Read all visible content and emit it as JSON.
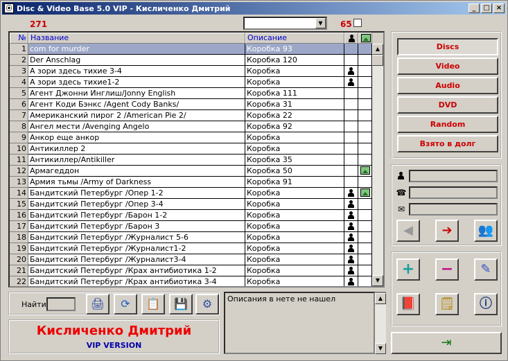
{
  "window": {
    "title": "Disc & Video Base 5.0  VIP -  Кисличенко Дмитрий",
    "app_icon": "disc-icon",
    "buttons": [
      "_",
      "□",
      "×"
    ]
  },
  "counts": {
    "total": "271",
    "right": "65"
  },
  "grid": {
    "headers": [
      "№",
      "Название",
      "Описание"
    ],
    "header_icons": [
      "person-icon",
      "picture-icon"
    ],
    "rows": [
      {
        "n": "1",
        "name": "com for murder",
        "desc": "Коробка 93",
        "person": false,
        "picture": false,
        "selected": true
      },
      {
        "n": "2",
        "name": "Der Anschlag",
        "desc": "Коробка 120",
        "person": false,
        "picture": false
      },
      {
        "n": "3",
        "name": "А зори здесь тихие 3-4",
        "desc": "Коробка",
        "person": true,
        "picture": false
      },
      {
        "n": "4",
        "name": "А зори здесь тихие1-2",
        "desc": "Коробка",
        "person": true,
        "picture": false
      },
      {
        "n": "5",
        "name": "Агент Джонни Инглиш/Jonny English",
        "desc": "Коробка 111",
        "person": false,
        "picture": false
      },
      {
        "n": "6",
        "name": "Агент Коди Бэнкс /Agent Cody Banks/",
        "desc": "Коробка 31",
        "person": false,
        "picture": false
      },
      {
        "n": "7",
        "name": "Американский пирог 2 /American Pie 2/",
        "desc": "Коробка 22",
        "person": false,
        "picture": false
      },
      {
        "n": "8",
        "name": "Ангел мести /Avenging Angelo",
        "desc": "Коробка 92",
        "person": false,
        "picture": false
      },
      {
        "n": "9",
        "name": "Анкор еще анкор",
        "desc": "Коробка",
        "person": false,
        "picture": false
      },
      {
        "n": "10",
        "name": "Антикиллер 2",
        "desc": "Коробка",
        "person": false,
        "picture": false
      },
      {
        "n": "11",
        "name": "Антикиллер/Antikiller",
        "desc": "Коробка 35",
        "person": false,
        "picture": false
      },
      {
        "n": "12",
        "name": "Армагеддон",
        "desc": "Коробка 50",
        "person": false,
        "picture": true
      },
      {
        "n": "13",
        "name": "Армия тьмы /Army of Darkness",
        "desc": "Коробка 91",
        "person": false,
        "picture": false
      },
      {
        "n": "14",
        "name": "Бандитский Петербург /Опер 1-2",
        "desc": "Коробка",
        "person": true,
        "picture": true
      },
      {
        "n": "15",
        "name": "Бандитский Петербург /Опер 3-4",
        "desc": "Коробка",
        "person": true,
        "picture": false
      },
      {
        "n": "16",
        "name": "Бандитский Петербург /Барон 1-2",
        "desc": "Коробка",
        "person": true,
        "picture": false
      },
      {
        "n": "17",
        "name": "Бандитский Петербург /Барон 3",
        "desc": "Коробка",
        "person": true,
        "picture": false
      },
      {
        "n": "18",
        "name": "Бандитский Петербург /Журналист 5-6",
        "desc": "Коробка",
        "person": true,
        "picture": false
      },
      {
        "n": "19",
        "name": "Бандитский Петербург /Журналист1-2",
        "desc": "Коробка",
        "person": true,
        "picture": false
      },
      {
        "n": "20",
        "name": "Бандитский Петербург /Журналист3-4",
        "desc": "Коробка",
        "person": true,
        "picture": false
      },
      {
        "n": "21",
        "name": "Бандитский Петербург /Крах антибиотика 1-2",
        "desc": "Коробка",
        "person": true,
        "picture": false
      },
      {
        "n": "22",
        "name": "Бандитский Петербург /Крах антибиотика 3-4",
        "desc": "Коробка",
        "person": true,
        "picture": false
      }
    ]
  },
  "categories": {
    "discs": "Discs",
    "video": "Video",
    "audio": "Audio",
    "dvd": "DVD",
    "random": "Random",
    "borrowed": "Взято в долг"
  },
  "search": {
    "label": "Найти",
    "value": ""
  },
  "description_text": "Описания в нете не нашел",
  "user": {
    "name": "Кисличенко Дмитрий",
    "version": "VIP VERSION"
  },
  "icons": {
    "toolbar": [
      "print-icon",
      "refresh-icon",
      "clipboard-icon",
      "save-icon",
      "settings-icon"
    ],
    "contact": [
      "person-icon",
      "phone-icon",
      "email-icon"
    ],
    "actions": [
      "back-icon",
      "forward-icon",
      "people-icon",
      "add-icon",
      "remove-icon",
      "edit-icon",
      "book-icon",
      "notes-icon",
      "info-icon",
      "exit-icon"
    ]
  }
}
